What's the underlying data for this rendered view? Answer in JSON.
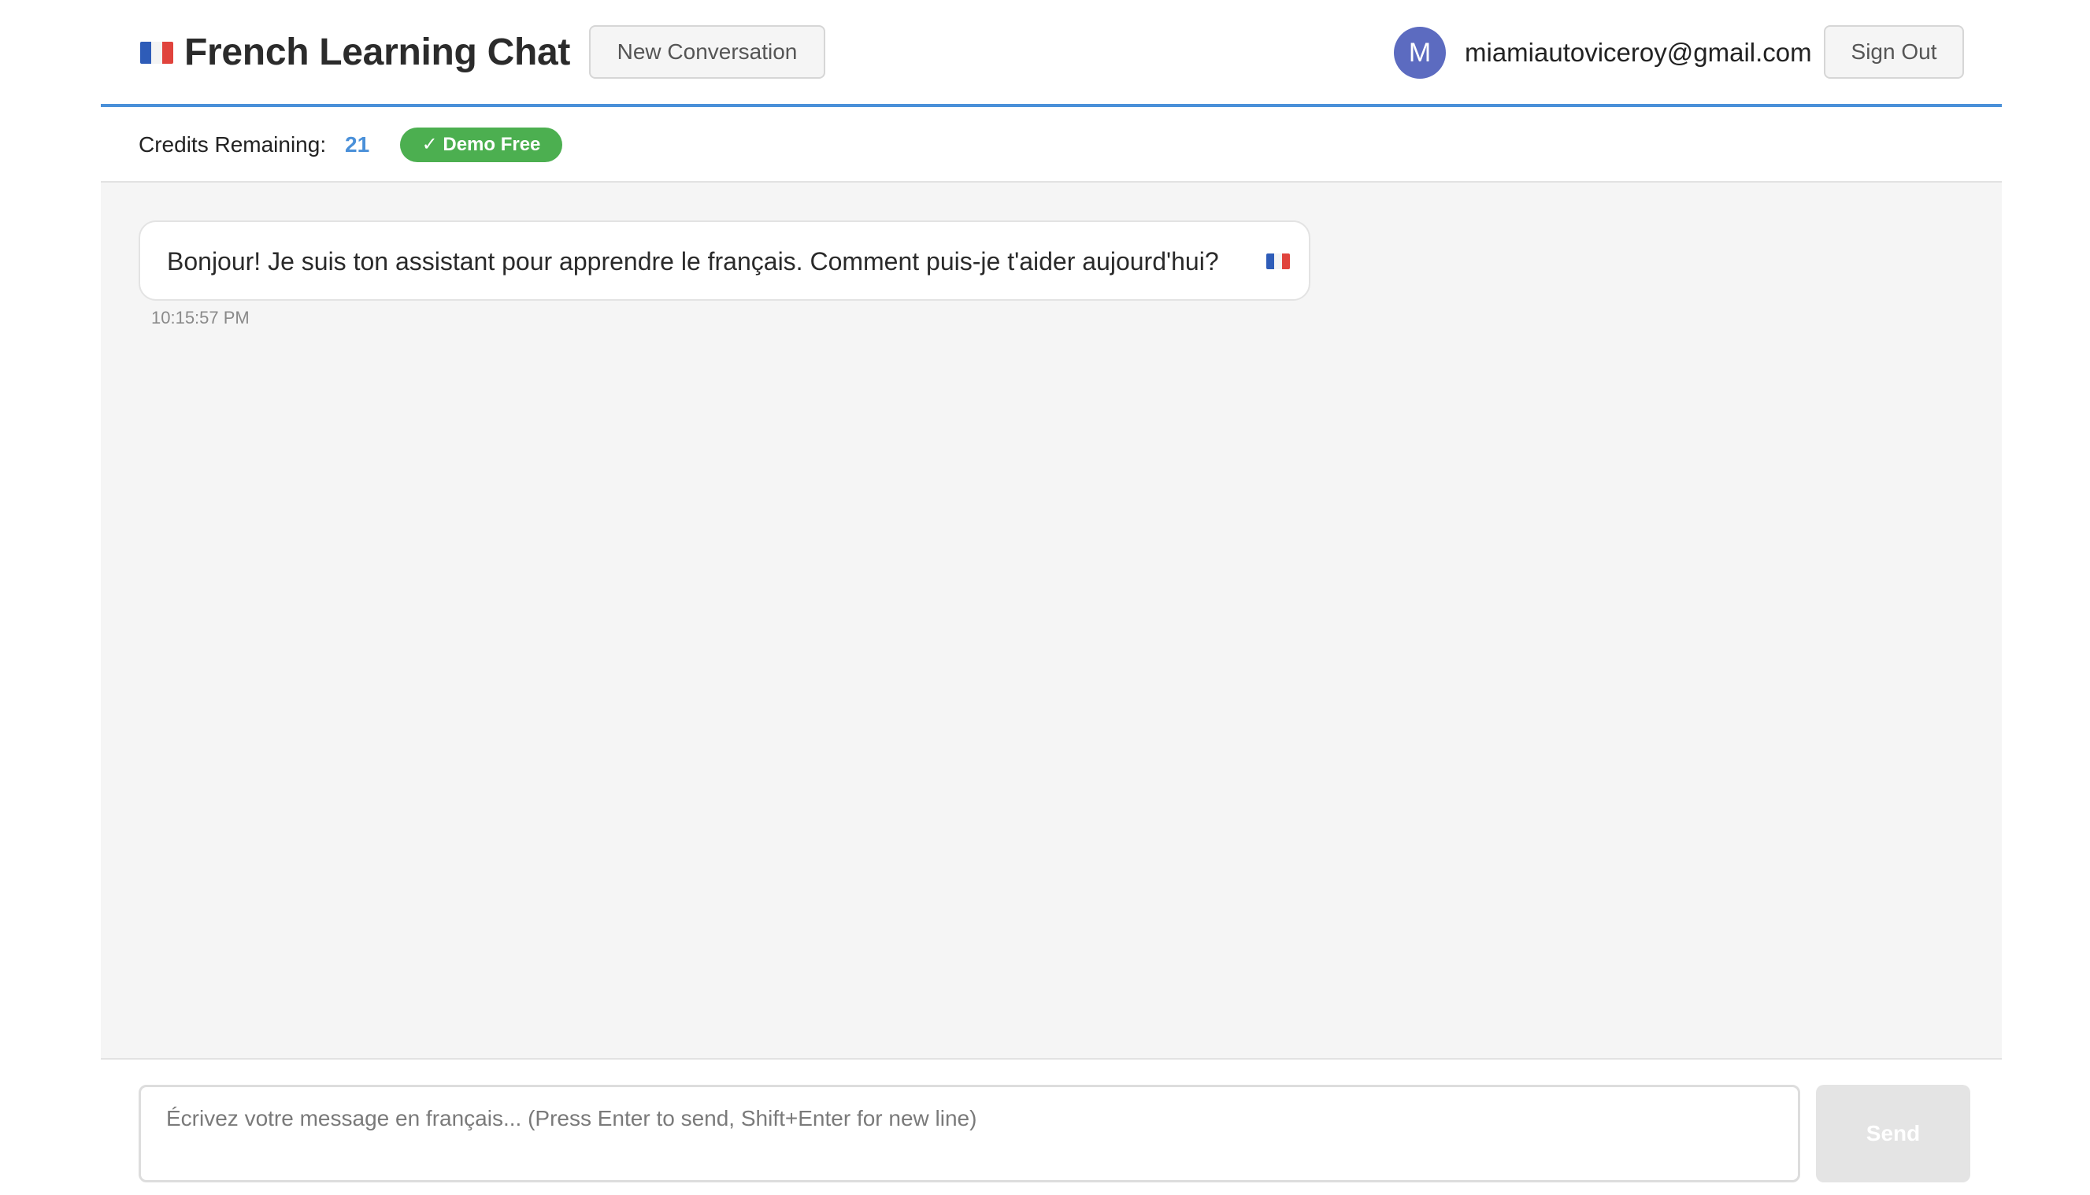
{
  "header": {
    "title": "French Learning Chat",
    "title_icon": "french-flag-icon",
    "new_conversation_label": "New Conversation",
    "user": {
      "avatar_initial": "M",
      "email": "miamiautoviceroy@gmail.com"
    },
    "sign_out_label": "Sign Out",
    "accent_color": "#4a90d9"
  },
  "credits": {
    "label": "Credits Remaining:",
    "value": "21",
    "badge": "✓ Demo Free",
    "badge_color": "#4caf50"
  },
  "messages": [
    {
      "role": "assistant",
      "text": "Bonjour! Je suis ton assistant pour apprendre le français. Comment puis-je t'aider aujourd'hui?",
      "trailing_icon": "french-flag-icon",
      "time": "10:15:57 PM"
    }
  ],
  "composer": {
    "placeholder": "Écrivez votre message en français... (Press Enter to send, Shift+Enter for new line)",
    "value": "",
    "send_label": "Send"
  }
}
